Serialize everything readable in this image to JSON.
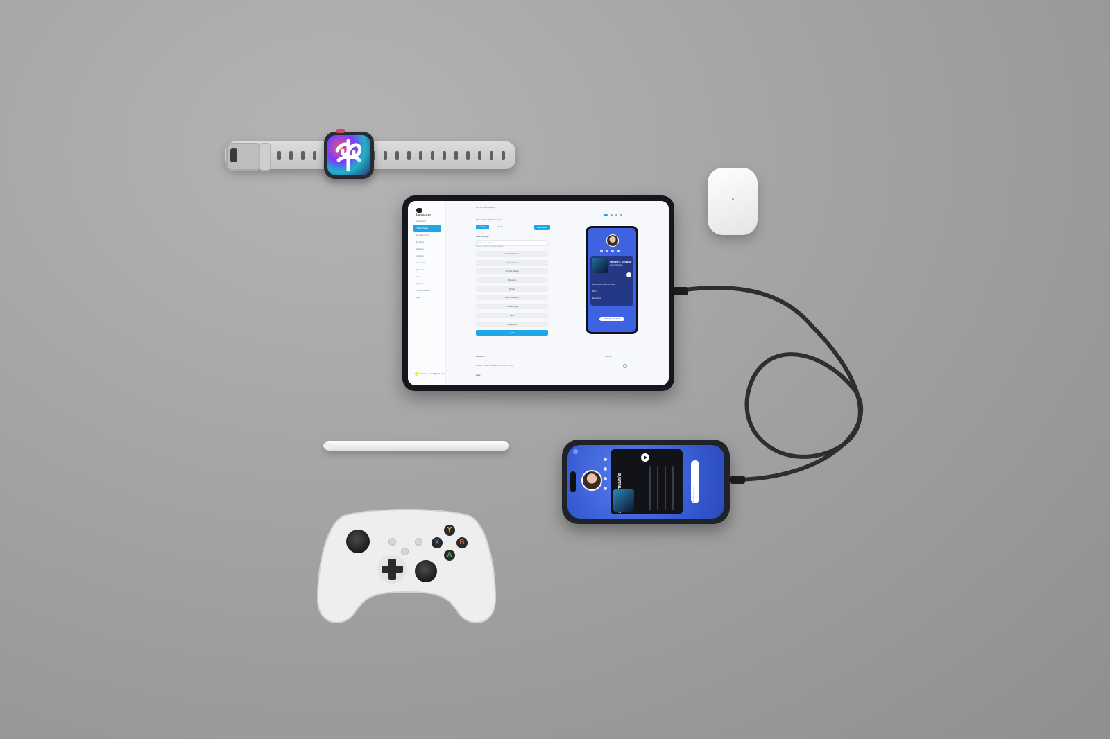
{
  "scene": {
    "background_color": "#a5a5a5",
    "accent_color": "#1ea7e6",
    "profile_blue": "#3f63e0"
  },
  "devices": [
    "smart-watch",
    "wireless-earbuds-case",
    "tablet",
    "stylus",
    "smartphone",
    "game-controller"
  ],
  "tablet": {
    "logo": "bento.me",
    "breadcrumb": "Link / Profile Settings",
    "nav": [
      "Dashboard",
      "Profile Pages",
      "Shortlink Links",
      "Bio Links",
      "Statistics",
      "Analytics",
      "Short Links",
      "QR Codes",
      "Store",
      "Projects",
      "Domain Names",
      "Blog"
    ],
    "page_title": "Share Link / Profile Settings",
    "tabs": {
      "edit": "Settings",
      "menu": "Blocks"
    },
    "dashboard_button": "Dashboard",
    "section": "Page Settings",
    "field": {
      "prefix": "bento.me/",
      "value": "atome"
    },
    "help": "Letters, numbers and dashes allowed",
    "rows": [
      "Select Themes",
      "Custom Fonts",
      "Verified Badge",
      "Branding",
      "Pixels",
      "Link Protection",
      "Private Page",
      "SEO",
      "Advanced"
    ],
    "update_button": "Update",
    "footer_logo": "bento.me",
    "footer_links": "Contact · Email Notifications · Terms & Privacy",
    "footer_view": "View",
    "language": "English",
    "user": "Atome · atome@mail.com"
  },
  "profile_preview": {
    "song": "United's Ground",
    "artist": "Atome Shinnam",
    "tracks": [
      "Wanna Know (Take Me Home)",
      "Want",
      "Better Days"
    ],
    "cta": "Create your own profile"
  },
  "phone": {
    "title": "atome Shinnam's",
    "cta": "Create your own"
  },
  "controller": {
    "buttons": [
      {
        "label": "Y",
        "color": "#e6c84a"
      },
      {
        "label": "X",
        "color": "#3a8ee6"
      },
      {
        "label": "B",
        "color": "#e0504c"
      },
      {
        "label": "A",
        "color": "#4fb85a"
      }
    ]
  }
}
